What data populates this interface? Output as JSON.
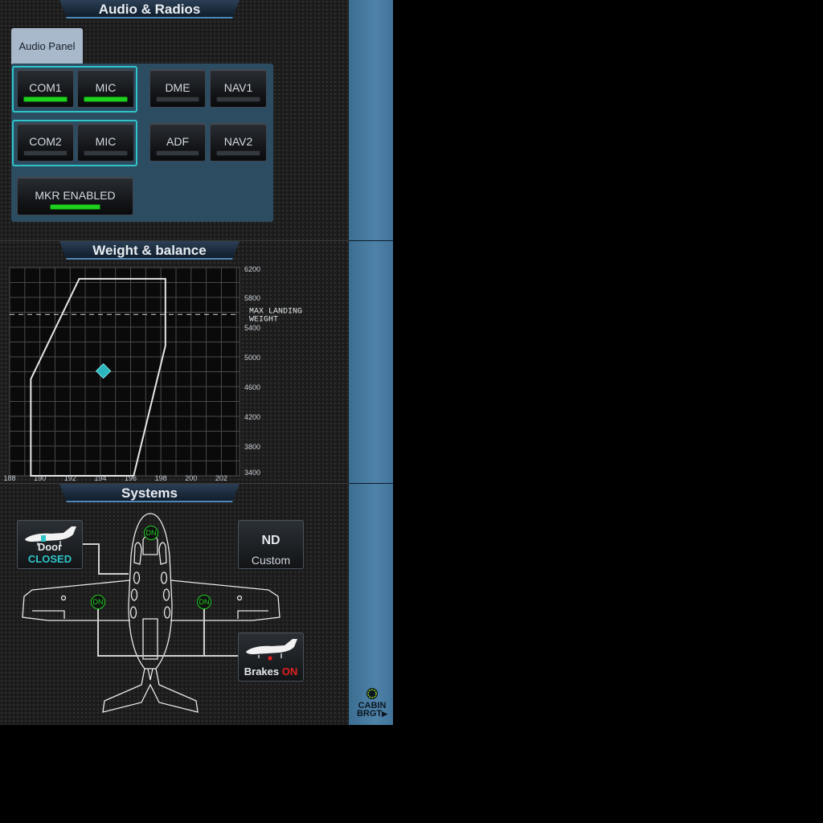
{
  "sections": {
    "audio_title": "Audio & Radios",
    "wb_title": "Weight & balance",
    "systems_title": "Systems"
  },
  "audio": {
    "tab_label": "Audio Panel",
    "buttons": [
      {
        "label": "COM1",
        "active": true
      },
      {
        "label": "MIC",
        "active": true
      },
      {
        "label": "DME",
        "active": false
      },
      {
        "label": "NAV1",
        "active": false
      },
      {
        "label": "COM2",
        "active": false
      },
      {
        "label": "MIC",
        "active": false
      },
      {
        "label": "ADF",
        "active": false
      },
      {
        "label": "NAV2",
        "active": false
      },
      {
        "label": "MKR ENABLED",
        "active": true
      }
    ]
  },
  "weight_balance": {
    "chart_data": {
      "type": "scatter",
      "x_ticks": [
        "188",
        "190",
        "192",
        "194",
        "196",
        "198",
        "200",
        "202"
      ],
      "y_ticks": [
        "6200",
        "5800",
        "5400",
        "5000",
        "4600",
        "4200",
        "3800",
        "3400"
      ],
      "xlim": [
        188,
        203.2
      ],
      "ylim": [
        3400,
        6200
      ],
      "grid": true,
      "envelope": [
        {
          "x": 189.4,
          "y": 3400
        },
        {
          "x": 189.4,
          "y": 4700
        },
        {
          "x": 192.6,
          "y": 6050
        },
        {
          "x": 198.3,
          "y": 6050
        },
        {
          "x": 198.3,
          "y": 5150
        },
        {
          "x": 196.2,
          "y": 3400
        }
      ],
      "reference_line": {
        "y": 5570,
        "label_line1": "MAX LANDING",
        "label_line2": "WEIGHT"
      },
      "points": [
        {
          "x": 194.2,
          "y": 4810
        }
      ],
      "colors": {
        "grid": "#4a4a4a",
        "envelope": "#e6e6e6",
        "point": "#2bb6bd"
      }
    }
  },
  "systems": {
    "door": {
      "label": "Door",
      "status": "CLOSED",
      "status_color": "#2fc4c8"
    },
    "nd": {
      "title": "ND",
      "subtitle": "Custom"
    },
    "brakes": {
      "label": "Brakes",
      "status": "ON",
      "status_color": "#e02020"
    },
    "gear": {
      "nose": "DN",
      "left": "DN",
      "right": "DN"
    }
  },
  "cabin_brightness": {
    "line1": "CABIN",
    "line2": "BRGT"
  }
}
